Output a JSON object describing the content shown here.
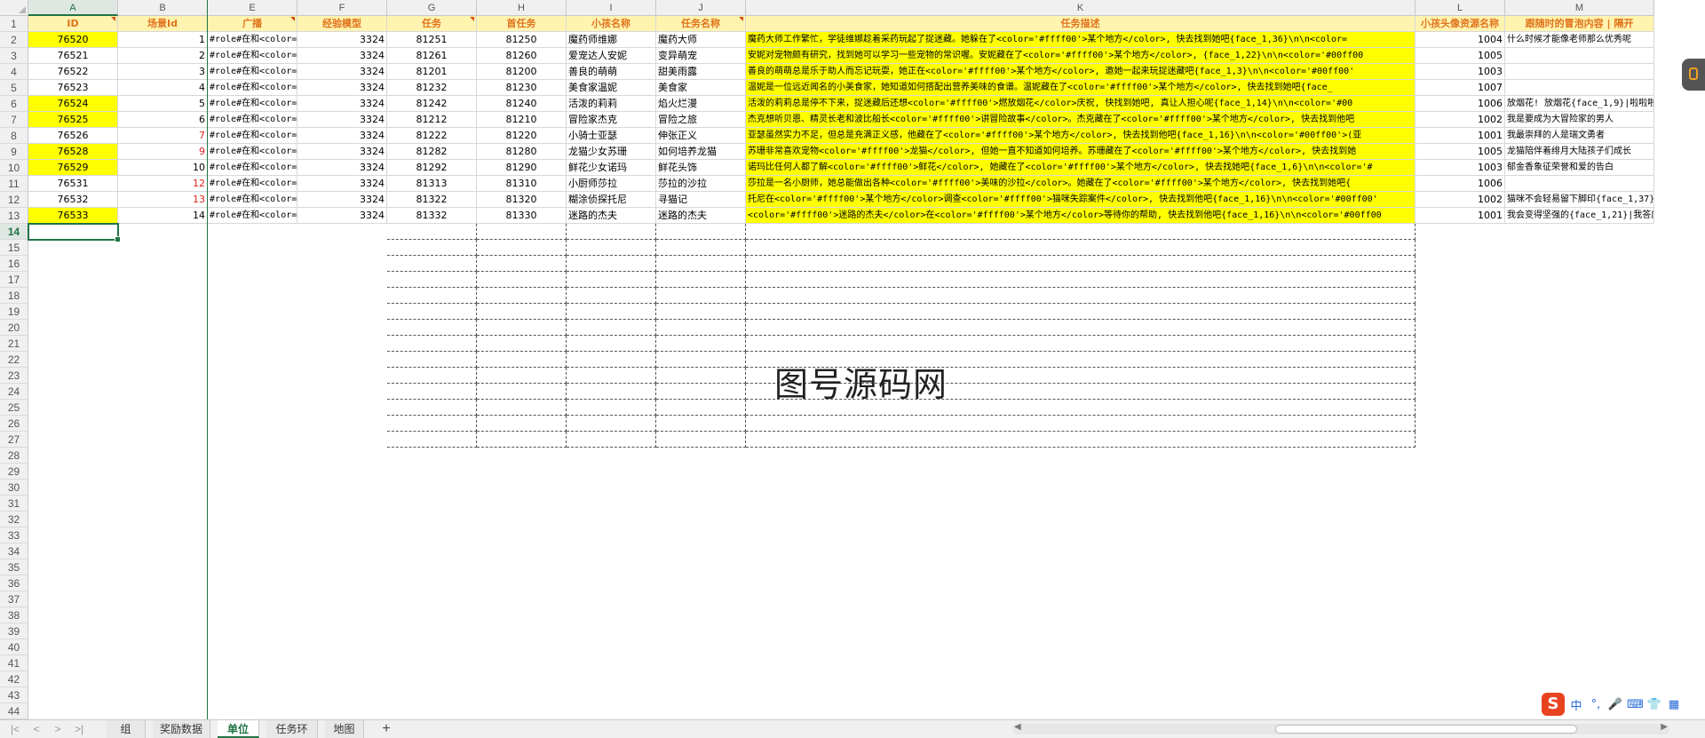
{
  "columns": [
    "A",
    "B",
    "E",
    "F",
    "G",
    "H",
    "I",
    "J",
    "K",
    "L",
    "M"
  ],
  "selected_column": "A",
  "header_row": {
    "A": "ID",
    "B": "场景Id",
    "E": "广播",
    "F": "经验模型",
    "G": "任务",
    "H": "首任务",
    "I": "小孩名称",
    "J": "任务名称",
    "K": "任务描述",
    "L": "小孩头像资源名称",
    "M": "跟随时的冒泡内容 | 隔开"
  },
  "rows": [
    {
      "A": "76520",
      "B": "1",
      "E": "#role#在和<color=",
      "F": "3324",
      "G": "81251",
      "H": "81250",
      "I": "魔药师维娜",
      "J": "魔药大师",
      "K": "魔药大师工作繁忙，学徒维娜趁着采药玩起了捉迷藏。她躲在了<color='#ffff00'>某个地方</color>, 快去找到她吧{face_1,36}\\n\\n<color=",
      "L": "1004",
      "M": "什么时候才能像老师那么优秀呢",
      "yA": true,
      "yK": true,
      "redB": false
    },
    {
      "A": "76521",
      "B": "2",
      "E": "#role#在和<color=",
      "F": "3324",
      "G": "81261",
      "H": "81260",
      "I": "爱宠达人安妮",
      "J": "变异萌宠",
      "K": "安妮对宠物颇有研究，找到她可以学习一些宠物的常识喔。安妮藏在了<color='#ffff00'>某个地方</color>, {face_1,22}\\n\\n<color='#00ff00",
      "L": "1005",
      "M": "",
      "yA": false,
      "yK": true,
      "redB": false
    },
    {
      "A": "76522",
      "B": "3",
      "E": "#role#在和<color=",
      "F": "3324",
      "G": "81201",
      "H": "81200",
      "I": "善良的萌萌",
      "J": "甜美雨露",
      "K": "善良的萌萌总是乐于助人而忘记玩耍，她正在<color='#ffff00'>某个地方</color>, 邀她一起来玩捉迷藏吧{face_1,3}\\n\\n<color='#00ff00'",
      "L": "1003",
      "M": "",
      "yA": false,
      "yK": true,
      "redB": false
    },
    {
      "A": "76523",
      "B": "4",
      "E": "#role#在和<color=",
      "F": "3324",
      "G": "81232",
      "H": "81230",
      "I": "美食家温妮",
      "J": "美食家",
      "K": "温妮是一位远近闻名的小美食家，她知道如何搭配出营养美味的食谱。温妮藏在了<color='#ffff00'>某个地方</color>, 快去找到她吧{face_",
      "L": "1007",
      "M": "",
      "yA": false,
      "yK": true,
      "redB": false
    },
    {
      "A": "76524",
      "B": "5",
      "E": "#role#在和<color=",
      "F": "3324",
      "G": "81242",
      "H": "81240",
      "I": "活泼的莉莉",
      "J": "焰火烂漫",
      "K": "活泼的莉莉总是停不下来，捉迷藏后还想<color='#ffff00'>燃放烟花</color>庆祝, 快找到她吧, 真让人担心呢{face_1,14}\\n\\n<color='#00",
      "L": "1006",
      "M": "放烟花! 放烟花{face_1,9}|啦啦啦~...",
      "yA": true,
      "yK": true,
      "redB": false
    },
    {
      "A": "76525",
      "B": "6",
      "E": "#role#在和<color=",
      "F": "3324",
      "G": "81212",
      "H": "81210",
      "I": "冒险家杰克",
      "J": "冒险之旅",
      "K": "杰克想听贝恩、精灵长老和波比船长<color='#ffff00'>讲冒险故事</color>。杰克藏在了<color='#ffff00'>某个地方</color>, 快去找到他吧",
      "L": "1002",
      "M": "我是要成为大冒险家的男人",
      "yA": true,
      "yK": true,
      "redB": false
    },
    {
      "A": "76526",
      "B": "7",
      "E": "#role#在和<color=",
      "F": "3324",
      "G": "81222",
      "H": "81220",
      "I": "小骑士亚瑟",
      "J": "伸张正义",
      "K": "亚瑟虽然实力不足，但总是充满正义感，他藏在了<color='#ffff00'>某个地方</color>, 快去找到他吧{face_1,16}\\n\\n<color='#00ff00'>(亚",
      "L": "1001",
      "M": "我最崇拜的人是瑞文勇者",
      "yA": false,
      "yK": true,
      "redB": true
    },
    {
      "A": "76528",
      "B": "9",
      "E": "#role#在和<color=",
      "F": "3324",
      "G": "81282",
      "H": "81280",
      "I": "龙猫少女苏珊",
      "J": "如何培养龙猫",
      "K": "苏珊非常喜欢宠物<color='#ffff00'>龙猫</color>, 但她一直不知道如何培养。苏珊藏在了<color='#ffff00'>某个地方</color>, 快去找到她",
      "L": "1005",
      "M": "龙猫陪伴着绯月大陆孩子们成长",
      "yA": true,
      "yK": true,
      "redB": true
    },
    {
      "A": "76529",
      "B": "10",
      "E": "#role#在和<color=",
      "F": "3324",
      "G": "81292",
      "H": "81290",
      "I": "鲜花少女诺玛",
      "J": "鲜花头饰",
      "K": "诺玛比任何人都了解<color='#ffff00'>鲜花</color>, 她藏在了<color='#ffff00'>某个地方</color>, 快去找她吧{face_1,6}\\n\\n<color='#",
      "L": "1003",
      "M": "郁金香象征荣誉和爱的告白",
      "yA": true,
      "yK": true,
      "redB": false
    },
    {
      "A": "76531",
      "B": "12",
      "E": "#role#在和<color=",
      "F": "3324",
      "G": "81313",
      "H": "81310",
      "I": "小厨师莎拉",
      "J": "莎拉的沙拉",
      "K": "莎拉是一名小厨师，她总能做出各种<color='#ffff00'>美味的沙拉</color>。她藏在了<color='#ffff00'>某个地方</color>, 快去找到她吧{",
      "L": "1006",
      "M": "",
      "yA": false,
      "yK": true,
      "redB": true
    },
    {
      "A": "76532",
      "B": "13",
      "E": "#role#在和<color=",
      "F": "3324",
      "G": "81322",
      "H": "81320",
      "I": "糊涂侦探托尼",
      "J": "寻猫记",
      "K": "托尼在<color='#ffff00'>某个地方</color>调查<color='#ffff00'>猫咪失踪案件</color>, 快去找到他吧{face_1,16}\\n\\n<color='#00ff00'",
      "L": "1002",
      "M": "猫咪不会轻易留下脚印{face_1,37}|",
      "yA": false,
      "yK": true,
      "redB": true
    },
    {
      "A": "76533",
      "B": "14",
      "E": "#role#在和<color=",
      "F": "3324",
      "G": "81332",
      "H": "81330",
      "I": "迷路的杰夫",
      "J": "迷路的杰夫",
      "K": "<color='#ffff00'>迷路的杰夫</color>在<color='#ffff00'>某个地方</color>等待你的帮助, 快去找到他吧{face_1,16}\\n\\n<color='#00ff00",
      "L": "1001",
      "M": "我会变得坚强的{face_1,21}|我答应",
      "yA": true,
      "yK": true,
      "redB": false
    }
  ],
  "row_numbers": [
    "1",
    "2",
    "3",
    "4",
    "5",
    "6",
    "7",
    "8",
    "9",
    "10",
    "11",
    "12",
    "13",
    "14",
    "15",
    "16",
    "17",
    "18",
    "19",
    "20",
    "21",
    "22",
    "23",
    "24",
    "25",
    "26",
    "27",
    "28",
    "29",
    "30",
    "31",
    "32",
    "33",
    "34",
    "35",
    "36",
    "37",
    "38",
    "39",
    "40",
    "41",
    "42",
    "43",
    "44"
  ],
  "selected_row": "14",
  "watermark": {
    "prefix": "图号",
    "highlight": "源码",
    "suffix": "网",
    "full": "图号源码网"
  },
  "tabs": [
    "组",
    "奖励数据",
    "单位",
    "任务环",
    "地图"
  ],
  "active_tab": "单位",
  "nav_icons": [
    "first-sheet-icon",
    "prev-sheet-icon",
    "next-sheet-icon",
    "last-sheet-icon"
  ],
  "add_tab_label": "+",
  "ime": {
    "logo": "S",
    "labels": [
      "中",
      "°,",
      "🎤",
      "⌨",
      "👕",
      "▦"
    ]
  },
  "colors": {
    "accent": "#217346",
    "header_fill": "#fff3b0",
    "header_text": "#e0731a",
    "highlight": "#ffff00",
    "red_text": "#e02020"
  }
}
